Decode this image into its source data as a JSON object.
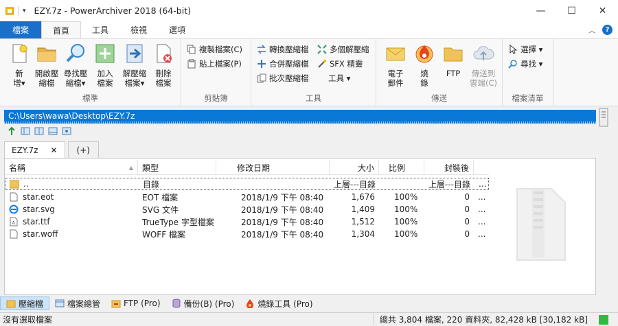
{
  "window": {
    "title": "EZY.7z - PowerArchiver 2018 (64-bit)",
    "minimize": "—",
    "maximize": "☐",
    "close": "✕"
  },
  "ribbon_tabs": [
    "檔案",
    "首頁",
    "工具",
    "檢視",
    "選項"
  ],
  "groups": {
    "standard": {
      "label": "標準",
      "new": "新\n增▾",
      "open": "開啟壓\n縮檔",
      "find": "尋找壓\n縮檔▾",
      "add": "加入\n檔案",
      "extract": "解壓縮\n檔案▾",
      "delete": "刪除\n檔案"
    },
    "clipboard": {
      "label": "剪貼簿",
      "copy": "複製檔案(C)",
      "paste": "貼上檔案(P)"
    },
    "tools": {
      "label": "工具",
      "convert": "轉換壓縮檔",
      "merge": "合併壓縮檔",
      "batch": "批次壓縮檔",
      "multi_extract": "多個解壓縮",
      "sfx": "SFX 精靈",
      "tools_menu": "工具 ▾"
    },
    "send": {
      "label": "傳送",
      "email": "電子\n郵件",
      "burn": "燒\n錄",
      "ftp": "FTP",
      "cloud": "傳送到\n雲端(C)"
    },
    "filelist": {
      "label": "檔案清單",
      "select": "選擇 ▾",
      "find": "尋找 ▾"
    }
  },
  "path": "C:\\Users\\wawa\\Desktop\\EZY.7z",
  "file_tabs": {
    "active": "EZY.7z",
    "close": "✕",
    "add": "(+)"
  },
  "columns": [
    "名稱",
    "類型",
    "修改日期",
    "大小",
    "比例",
    "封裝後"
  ],
  "rows": [
    {
      "name": "..",
      "type": "目錄",
      "date": "",
      "size": "上層---目錄",
      "ratio": "",
      "packed": "上層---目錄",
      "icon": "folder-icon"
    },
    {
      "name": "star.eot",
      "type": "EOT 檔案",
      "date": "2018/1/9 下午 08:40",
      "size": "1,676",
      "ratio": "100%",
      "packed": "0",
      "icon": "file-icon"
    },
    {
      "name": "star.svg",
      "type": "SVG 文件",
      "date": "2018/1/9 下午 08:40",
      "size": "1,409",
      "ratio": "100%",
      "packed": "0",
      "icon": "ie-file-icon"
    },
    {
      "name": "star.ttf",
      "type": "TrueType 字型檔案",
      "date": "2018/1/9 下午 08:40",
      "size": "1,512",
      "ratio": "100%",
      "packed": "0",
      "icon": "font-file-icon"
    },
    {
      "name": "star.woff",
      "type": "WOFF 檔案",
      "date": "2018/1/9 下午 08:40",
      "size": "1,304",
      "ratio": "100%",
      "packed": "0",
      "icon": "file-icon"
    }
  ],
  "ellipsis": "...",
  "bottom_tabs": [
    "壓縮檔",
    "檔案總管",
    "FTP (Pro)",
    "備份(B) (Pro)",
    "燒錄工具 (Pro)"
  ],
  "status": {
    "left": "沒有選取檔案",
    "right": "總共 3,804 檔案, 220 資料夾, 82,428 kB [30,182 kB]"
  },
  "colors": {
    "accent": "#1a6fc9",
    "path_bar": "#0a78d7",
    "status_ok": "#2dbb44"
  }
}
